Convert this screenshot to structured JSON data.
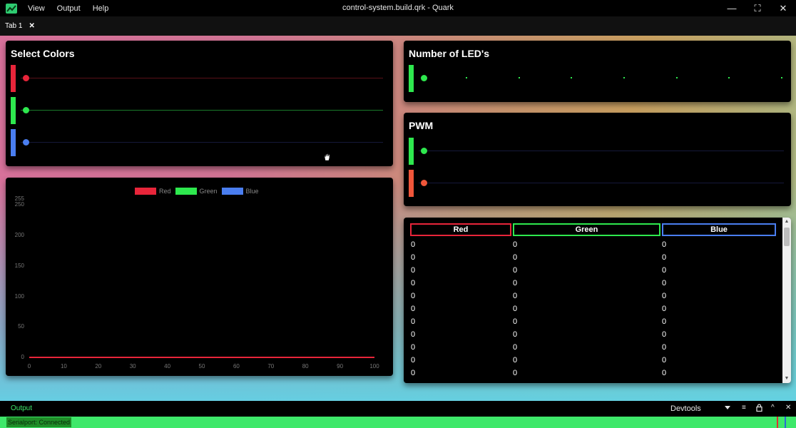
{
  "app": {
    "title": "control-system.build.qrk - Quark",
    "menu": [
      "View",
      "Output",
      "Help"
    ]
  },
  "tabs": [
    {
      "label": "Tab 1",
      "close": "✕"
    }
  ],
  "window_controls": {
    "minimize": "—",
    "maximize": "⛶",
    "close": "✕"
  },
  "select_colors": {
    "title": "Select Colors",
    "sliders": [
      {
        "name": "red",
        "color": "#e8253a",
        "track": "#5a1017",
        "value": 0
      },
      {
        "name": "green",
        "color": "#2ee84e",
        "track": "#1a7a2b",
        "value": 0
      },
      {
        "name": "blue",
        "color": "#4a7ef0",
        "track": "#15183a",
        "value": 0
      }
    ]
  },
  "leds": {
    "title": "Number of LED's",
    "color": "#2ee84e",
    "value": 0,
    "ticks": 8
  },
  "pwm": {
    "title": "PWM",
    "sliders": [
      {
        "name": "pwm-green",
        "color": "#2ee84e",
        "value": 0
      },
      {
        "name": "pwm-orange",
        "color": "#f0563a",
        "value": 0
      }
    ]
  },
  "chart_data": {
    "type": "line",
    "series": [
      {
        "name": "Red",
        "color": "#e8253a",
        "x": [
          0,
          100
        ],
        "values": [
          0,
          0
        ]
      },
      {
        "name": "Green",
        "color": "#2ee84e",
        "x": [
          0,
          100
        ],
        "values": [
          0,
          0
        ]
      },
      {
        "name": "Blue",
        "color": "#4a7ef0",
        "x": [
          0,
          100
        ],
        "values": [
          0,
          0
        ]
      }
    ],
    "xticks": [
      "0",
      "10",
      "20",
      "30",
      "40",
      "50",
      "60",
      "70",
      "80",
      "90",
      "100"
    ],
    "yticks": [
      "0",
      "50",
      "100",
      "150",
      "200",
      "250"
    ],
    "ytick_top": "255",
    "xlim": [
      0,
      100
    ],
    "ylim": [
      0,
      255
    ]
  },
  "table": {
    "headers": [
      {
        "label": "Red",
        "color": "#e8253a"
      },
      {
        "label": "Green",
        "color": "#2ee84e"
      },
      {
        "label": "Blue",
        "color": "#4a7ef0"
      }
    ],
    "rows": [
      [
        "0",
        "0",
        "0"
      ],
      [
        "0",
        "0",
        "0"
      ],
      [
        "0",
        "0",
        "0"
      ],
      [
        "0",
        "0",
        "0"
      ],
      [
        "0",
        "0",
        "0"
      ],
      [
        "0",
        "0",
        "0"
      ],
      [
        "0",
        "0",
        "0"
      ],
      [
        "0",
        "0",
        "0"
      ],
      [
        "0",
        "0",
        "0"
      ],
      [
        "0",
        "0",
        "0"
      ],
      [
        "0",
        "0",
        "0"
      ]
    ]
  },
  "bottom": {
    "output_label": "Output",
    "devtools_label": "Devtools",
    "status": "Serialport: Connected"
  }
}
